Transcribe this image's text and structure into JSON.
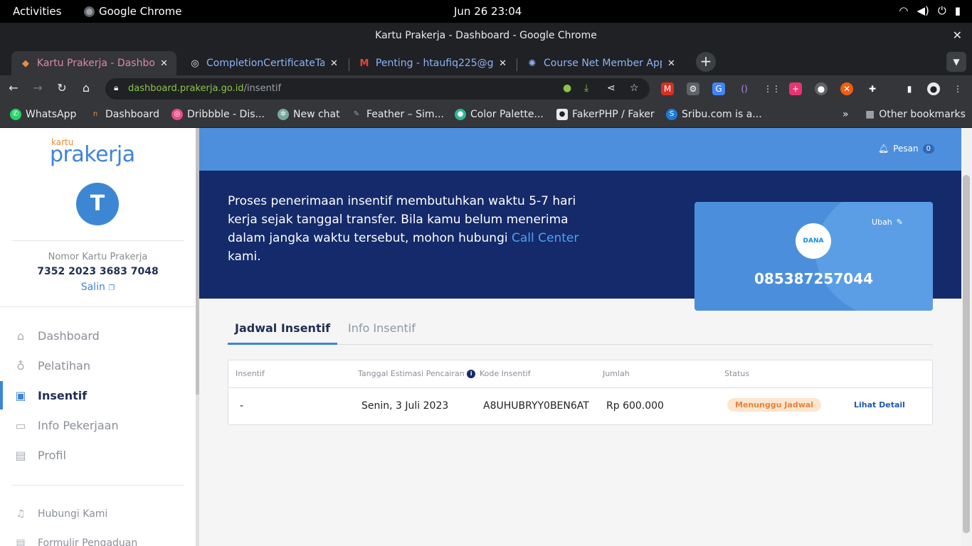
{
  "system": {
    "activities": "Activities",
    "app_name": "Google Chrome",
    "clock": "Jun 26  23:04",
    "tray_icons": [
      "wifi-icon",
      "volume-icon",
      "power-icon",
      "battery-icon"
    ]
  },
  "window": {
    "title": "Kartu Prakerja - Dashboard - Google Chrome"
  },
  "tabs": [
    {
      "label": "Kartu Prakerja - Dashboard",
      "icon": "prakerja-favicon",
      "active": true
    },
    {
      "label": "CompletionCertificateTa",
      "icon": "globe-icon",
      "active": false
    },
    {
      "label": "Penting - htaufiq225@gm",
      "icon": "gmail-icon",
      "active": false
    },
    {
      "label": "Course Net Member App",
      "icon": "coursenet-icon",
      "active": false
    }
  ],
  "address_bar": {
    "host": "dashboard.prakerja.go.id",
    "path": "/insentif"
  },
  "bookmarks": [
    {
      "label": "WhatsApp"
    },
    {
      "label": "Dashboard"
    },
    {
      "label": "Dribbble - Dis..."
    },
    {
      "label": "New chat"
    },
    {
      "label": "Feather – Sim..."
    },
    {
      "label": "Color Palette..."
    },
    {
      "label": "FakerPHP / Faker"
    },
    {
      "label": "Sribu.com is a..."
    }
  ],
  "bookmarks_overflow": "»",
  "other_bookmarks": "Other bookmarks",
  "sidebar": {
    "logo_small": "kartu",
    "logo_big": "prakerja",
    "avatar_initial": "T",
    "card_label": "Nomor Kartu Prakerja",
    "card_number": "7352 2023 3683 7048",
    "copy_label": "Salin",
    "nav": [
      {
        "label": "Dashboard",
        "icon": "home-icon"
      },
      {
        "label": "Pelatihan",
        "icon": "award-icon"
      },
      {
        "label": "Insentif",
        "icon": "money-icon"
      },
      {
        "label": "Info Pekerjaan",
        "icon": "briefcase-icon"
      },
      {
        "label": "Profil",
        "icon": "profile-icon"
      }
    ],
    "nav_secondary": [
      {
        "label": "Hubungi Kami",
        "icon": "headset-icon"
      },
      {
        "label": "Formulir Pengaduan",
        "icon": "form-icon"
      }
    ]
  },
  "header": {
    "messages_label": "Pesan",
    "messages_count": "0"
  },
  "banner": {
    "text_before": "Proses penerimaan insentif membutuhkan waktu 5-7 hari kerja sejak tanggal transfer. Bila kamu belum menerima dalam jangka waktu tersebut, mohon hubungi ",
    "link_text": "Call Center",
    "text_after": " kami."
  },
  "wallet": {
    "edit_label": "Ubah",
    "logo_text": "DANA",
    "phone": "085387257044"
  },
  "content_tabs": [
    {
      "label": "Jadwal Insentif",
      "active": true
    },
    {
      "label": "Info Insentif",
      "active": false
    }
  ],
  "table": {
    "headers": [
      "Insentif",
      "Tanggal Estimasi Pencairan",
      "Kode Insentif",
      "Jumlah",
      "Status"
    ],
    "rows": [
      {
        "insentif": "-",
        "tanggal": "Senin, 3 Juli 2023",
        "kode": "A8UHUBRYY0BEN6AT",
        "jumlah": "Rp 600.000",
        "status": "Menunggu Jadwal",
        "action": "Lihat Detail"
      }
    ]
  },
  "colors": {
    "header_blue": "#4d8fdc",
    "banner_navy": "#142a6a",
    "accent": "#3d86d3",
    "status_bg": "#fde6cf",
    "status_text": "#e8823a"
  }
}
